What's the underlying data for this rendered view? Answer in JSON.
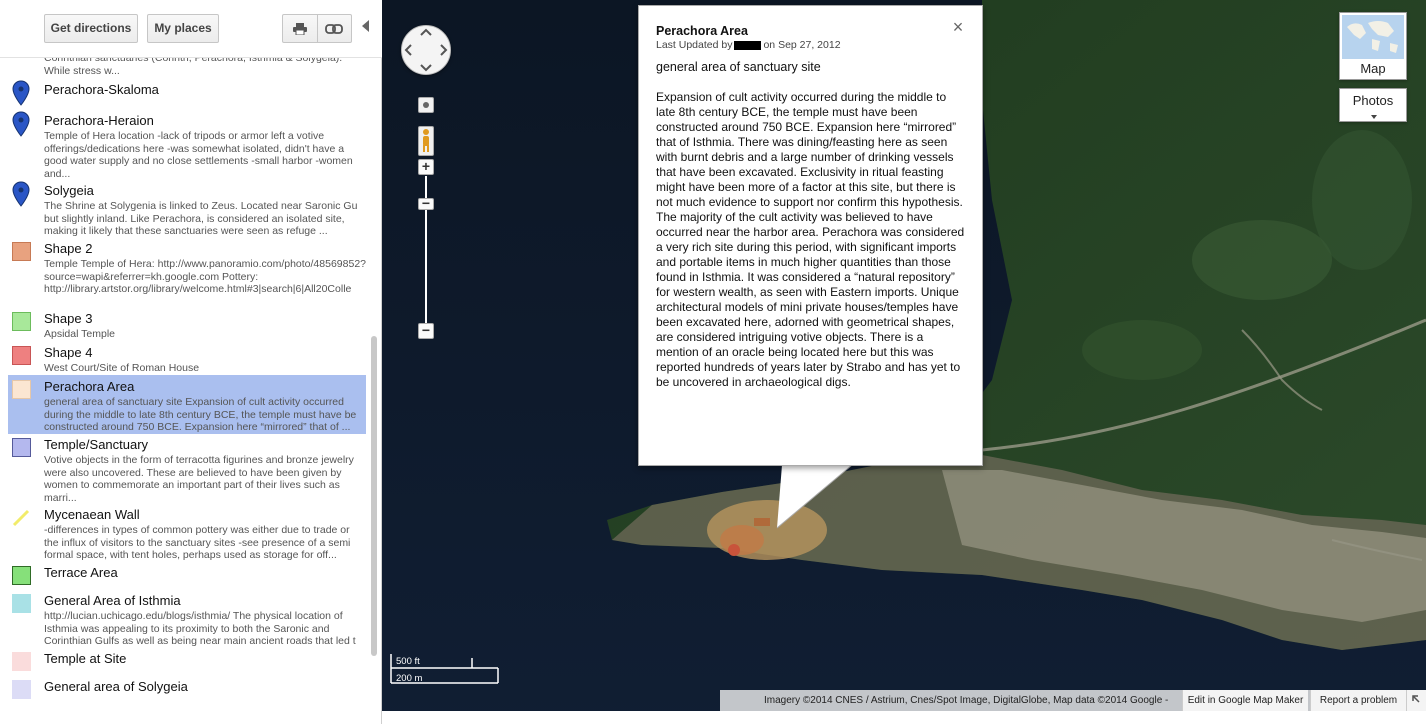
{
  "toolbar": {
    "get_directions": "Get directions",
    "my_places": "My places",
    "print_icon": "print-icon",
    "link_icon": "link-icon"
  },
  "list": {
    "items": [
      {
        "title": "",
        "desc": "Corinthian sanctuaries (Corinth, Perachora, Isthmia & Solygeia). While stress w...",
        "marker": "none"
      },
      {
        "title": "Perachora-Skaloma",
        "desc": "",
        "marker": "blue-pin"
      },
      {
        "title": "Perachora-Heraion",
        "desc": "Temple of Hera location -lack of tripods or armor left a votive offerings/dedications here -was somewhat isolated, didn't have a good water supply and no close settlements -small harbor -women and...",
        "marker": "blue-pin"
      },
      {
        "title": "Solygeia",
        "desc": "The Shrine at Solygenia is linked to Zeus. Located near Saronic Gu but slightly inland. Like Perachora, is considered an isolated site, making it likely that these sanctuaries were seen as refuge ...",
        "marker": "blue-pin"
      },
      {
        "title": "Shape 2",
        "desc": "Temple Temple of Hera: http://www.panoramio.com/photo/48569852?source=wapi&referrer=kh.google.com Pottery: http://library.artstor.org/library/welcome.html#3|search|6|All20Colle",
        "marker": "swatch",
        "fill": "#e8a27f",
        "border": "#c77a55"
      },
      {
        "title": "Shape 3",
        "desc": "Apsidal Temple",
        "marker": "swatch",
        "fill": "#a8e89a",
        "border": "#6cbc5c"
      },
      {
        "title": "Shape 4",
        "desc": "West Court/Site of Roman House",
        "marker": "swatch",
        "fill": "#ee8080",
        "border": "#c85555"
      },
      {
        "title": "Perachora Area",
        "desc": "general area of sanctuary site Expansion of cult activity occurred during the middle to late 8th century BCE, the temple must have be constructed around 750 BCE. Expansion here “mirrored” that of ...",
        "marker": "swatch",
        "fill": "#fbe6d2",
        "border": "#e6c7a8",
        "selected": true
      },
      {
        "title": "Temple/Sanctuary",
        "desc": "Votive objects in the form of terracotta figurines and bronze jewelry were also uncovered. These are believed to have been given by women to commemorate an important part of their lives such as marri...",
        "marker": "swatch",
        "fill": "#b4b8ee",
        "border": "#555a9a"
      },
      {
        "title": "Mycenaean Wall",
        "desc": "-differences in types of common pottery was either due to trade or the influx of visitors to the sanctuary sites -see presence of a semi formal space, with tent holes, perhaps used as storage for off...",
        "marker": "line",
        "fill": "#f2ec6a"
      },
      {
        "title": "Terrace Area",
        "desc": "",
        "marker": "swatch",
        "fill": "#86e07a",
        "border": "#2f6b26"
      },
      {
        "title": "General Area of Isthmia",
        "desc": "http://lucian.uchicago.edu/blogs/isthmia/ The physical location of Isthmia was appealing to its proximity to both the Saronic and Corinthian Gulfs as well as being near main ancient roads that led t",
        "marker": "swatch",
        "fill": "#a9e1e6",
        "border": "#a9e1e6"
      },
      {
        "title": "Temple at Site",
        "desc": "",
        "marker": "swatch",
        "fill": "#fadcdc",
        "border": "#fadcdc"
      },
      {
        "title": "General area of Solygeia",
        "desc": "",
        "marker": "swatch",
        "fill": "#dcdcf6",
        "border": "#dcdcf6"
      }
    ]
  },
  "map": {
    "map_type_label": "Map",
    "photos_label": "Photos",
    "scale_ft": "500 ft",
    "scale_m": "200 m",
    "attribution": "Imagery ©2014 CNES / Astrium, Cnes/Spot Image, DigitalGlobe, Map data ©2014 Google -",
    "edit_link": "Edit in Google Map Maker",
    "report_link": "Report a problem"
  },
  "infowindow": {
    "title": "Perachora Area",
    "meta_prefix": "Last Updated by",
    "meta_suffix": "on Sep 27, 2012",
    "summary": "general area of sanctuary site",
    "body": "Expansion of cult activity occurred during the middle to late 8th century BCE, the temple must have been constructed around 750 BCE. Expansion here “mirrored” that of Isthmia. There was dining/feasting here as seen with burnt debris and a large number of drinking vessels that have been excavated. Exclusivity in ritual feasting might have been more of a factor at this site, but there is not much evidence to support nor confirm this hypothesis. The majority of the cult activity was believed to have occurred near the harbor area. Perachora was considered a very rich site during this period, with significant imports and portable items in much higher quantities than those found in Isthmia. It was considered a “natural repository” for western wealth, as seen with Eastern imports. Unique architectural models of mini private houses/temples have been excavated here, adorned with geometrical shapes, are considered intriguing votive objects. There is a mention of an oracle being located here but this was reported hundreds of years later by Strabo and has yet to be uncovered in archaeological digs."
  },
  "colors": {
    "selection": "#aabfef",
    "pin_blue": "#2a56c6"
  }
}
